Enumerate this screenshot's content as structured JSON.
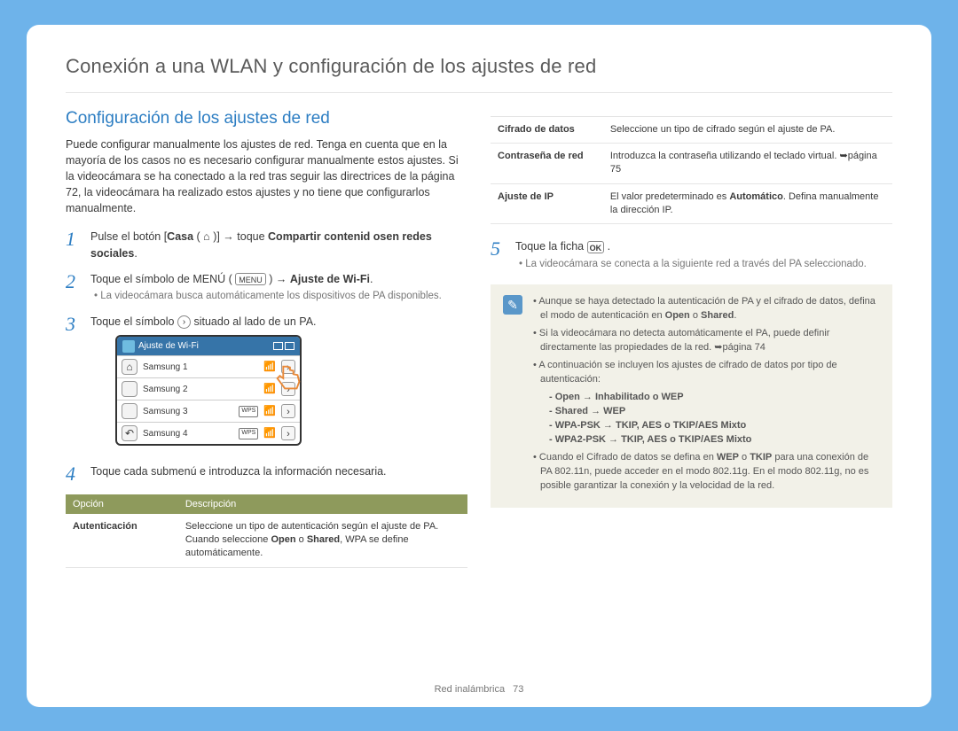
{
  "page_title": "Conexión a una WLAN y configuración de los ajustes de red",
  "section_title": "Configuración de los ajustes de red",
  "intro": "Puede configurar manualmente los ajustes de red. Tenga en cuenta que en la mayoría de los casos no es necesario configurar manualmente estos ajustes. Si la videocámara se ha conectado a la red tras seguir las directrices de la página 72, la videocámara ha realizado estos ajustes y no tiene que configurarlos manualmente.",
  "steps": {
    "s1": {
      "pre": "Pulse el botón [",
      "casa": "Casa",
      "mid": " ( ⌂ )] → toque ",
      "compartir": "Compartir contenid osen redes sociales",
      "post": "."
    },
    "s2": {
      "main_a": "Toque el símbolo de MENÚ ( ",
      "menu": "MENU",
      "main_b": " ) → ",
      "ajuste": "Ajuste de Wi-Fi",
      "dot": ".",
      "sub": "La videocámara busca automáticamente los dispositivos de PA disponibles."
    },
    "s3": {
      "a": "Toque el símbolo ",
      "b": " situado al lado de un PA."
    },
    "s4": "Toque cada submenú e introduzca la información necesaria.",
    "s5": {
      "a": "Toque la ficha ",
      "ok": "OK",
      "b": " .",
      "sub": "La videocámara se conecta a la siguiente red a través del PA seleccionado."
    }
  },
  "device": {
    "title": "Ajuste de Wi-Fi",
    "rows": [
      "Samsung 1",
      "Samsung 2",
      "Samsung 3",
      "Samsung 4"
    ]
  },
  "opt_header": {
    "c1": "Opción",
    "c2": "Descripción"
  },
  "opt_left": [
    {
      "name": "Autenticación",
      "desc_a": "Seleccione un tipo de autenticación según el ajuste de PA. Cuando seleccione ",
      "desc_b": "Open",
      "desc_c": " o ",
      "desc_d": "Shared",
      "desc_e": ", WPA se define automáticamente."
    }
  ],
  "opt_right": [
    {
      "name": "Cifrado de datos",
      "desc": "Seleccione un tipo de cifrado según el ajuste de PA."
    },
    {
      "name": "Contraseña de red",
      "desc": "Introduzca la contraseña utilizando el teclado virtual. ",
      "pgref": "página 75"
    },
    {
      "name": "Ajuste de IP",
      "desc_a": "El valor predeterminado es ",
      "desc_b": "Automático",
      "desc_c": ". Defina manualmente la dirección IP."
    }
  ],
  "note": {
    "li1": {
      "a": "Aunque se haya detectado la autenticación de PA y el cifrado de datos, defina el modo de autenticación en ",
      "b": "Open",
      "c": " o ",
      "d": "Shared",
      "e": "."
    },
    "li2": {
      "a": "Si la videocámara no detecta automáticamente el PA, puede definir directamente las propiedades de la red. ",
      "pgref": "página 74"
    },
    "li3": "A continuación se incluyen los ajustes de cifrado de datos por tipo de autenticación:",
    "sub": [
      "Open → Inhabilitado o WEP",
      "Shared → WEP",
      "WPA-PSK → TKIP, AES o TKIP/AES Mixto",
      "WPA2-PSK → TKIP, AES o TKIP/AES Mixto"
    ],
    "li4": {
      "a": "Cuando el Cifrado de datos se defina en ",
      "b": "WEP",
      "c": " o ",
      "d": "TKIP",
      "e": " para una conexión de PA 802.11n, puede acceder en el modo 802.11g. En el modo 802.11g, no es posible garantizar la conexión y la velocidad de la red."
    }
  },
  "footer": {
    "label": "Red inalámbrica",
    "page": "73"
  }
}
